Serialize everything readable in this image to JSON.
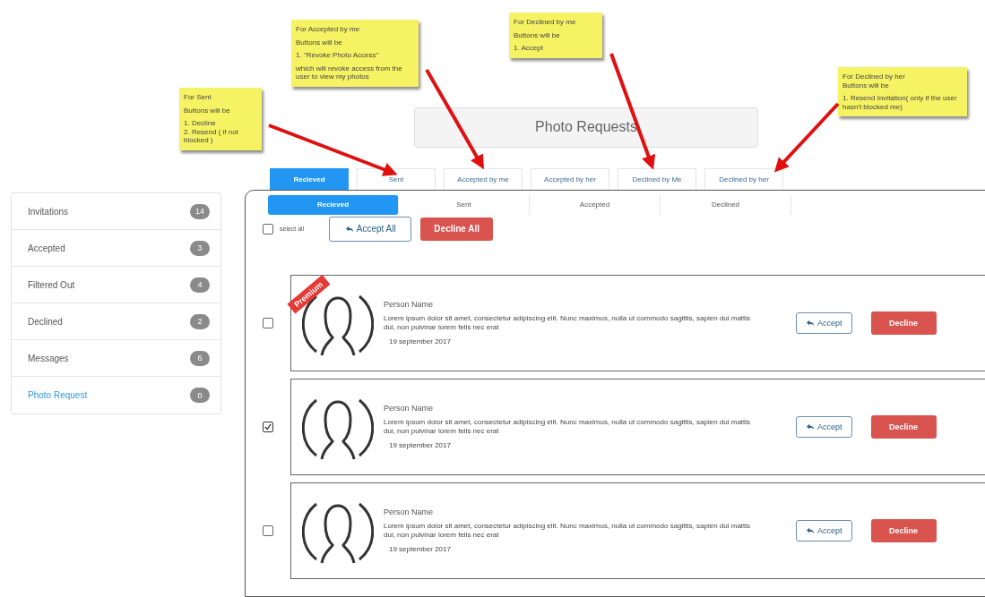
{
  "notes": [
    {
      "lines": [
        "For Sent",
        "Buttons will be",
        "1. Decline\n2. Resend ( if not blocked )"
      ]
    },
    {
      "lines": [
        "For Accepted by me",
        "Buttons will be",
        "1. \"Revoke Photo Access\"",
        "which will revoke access from the user to view my photos"
      ]
    },
    {
      "lines": [
        "For Declined by me",
        "Buttons will be",
        "1. Accept"
      ]
    },
    {
      "lines": [
        "For Declined by her\nButtons will be",
        "1. Resend Invitation( only if the user hasn't blocked me)"
      ]
    }
  ],
  "title": "Photo Requests",
  "top_tabs": [
    {
      "label": "Recieved",
      "selected": true
    },
    {
      "label": "Sent",
      "selected": false
    },
    {
      "label": "Accepted by me",
      "selected": false
    },
    {
      "label": "Accepted by her",
      "selected": false
    },
    {
      "label": "Declined by Me",
      "selected": false
    },
    {
      "label": "Declined by her",
      "selected": false
    }
  ],
  "sidebar": {
    "items": [
      {
        "label": "Invitations",
        "count": "14",
        "selected": false
      },
      {
        "label": "Accepted",
        "count": "3",
        "selected": false
      },
      {
        "label": "Filtered Out",
        "count": "4",
        "selected": false
      },
      {
        "label": "Declined",
        "count": "2",
        "selected": false
      },
      {
        "label": "Messages",
        "count": "6",
        "selected": false
      },
      {
        "label": "Photo Request",
        "count": "0",
        "selected": true
      }
    ]
  },
  "sub_tabs": [
    {
      "label": "Recieved",
      "selected": true
    },
    {
      "label": "Sent",
      "selected": false
    },
    {
      "label": "Accepted",
      "selected": false
    },
    {
      "label": "Declined",
      "selected": false
    }
  ],
  "select_all": {
    "label": "select all",
    "checked": false
  },
  "accept_all": "Accept All",
  "decline_all": "Decline All",
  "requests": [
    {
      "checked": false,
      "premium": "Premium",
      "name": "Person Name",
      "text": "Lorem ipsum dolor sit amet, consectetur adipiscing elit. Nunc maximus, nulla ut commodo sagittis, sapien dui mattis dui, non pulvinar lorem felis nec erat",
      "date": "19 september 2017",
      "accept": "Accept",
      "decline": "Decline"
    },
    {
      "checked": true,
      "name": "Person Name",
      "text": "Lorem ipsum dolor sit amet, consectetur adipiscing elit. Nunc maximus, nulla ut commodo sagittis, sapien dui mattis dui, non pulvinar lorem felis nec erat",
      "date": "19 september 2017",
      "accept": "Accept",
      "decline": "Decline"
    },
    {
      "checked": false,
      "name": "Person Name",
      "text": "Lorem ipsum dolor sit amet, consectetur adipiscing elit. Nunc maximus, nulla ut commodo sagittis, sapien dui mattis dui, non pulvinar lorem felis nec erat",
      "date": "19 september 2017",
      "accept": "Accept",
      "decline": "Decline"
    }
  ]
}
